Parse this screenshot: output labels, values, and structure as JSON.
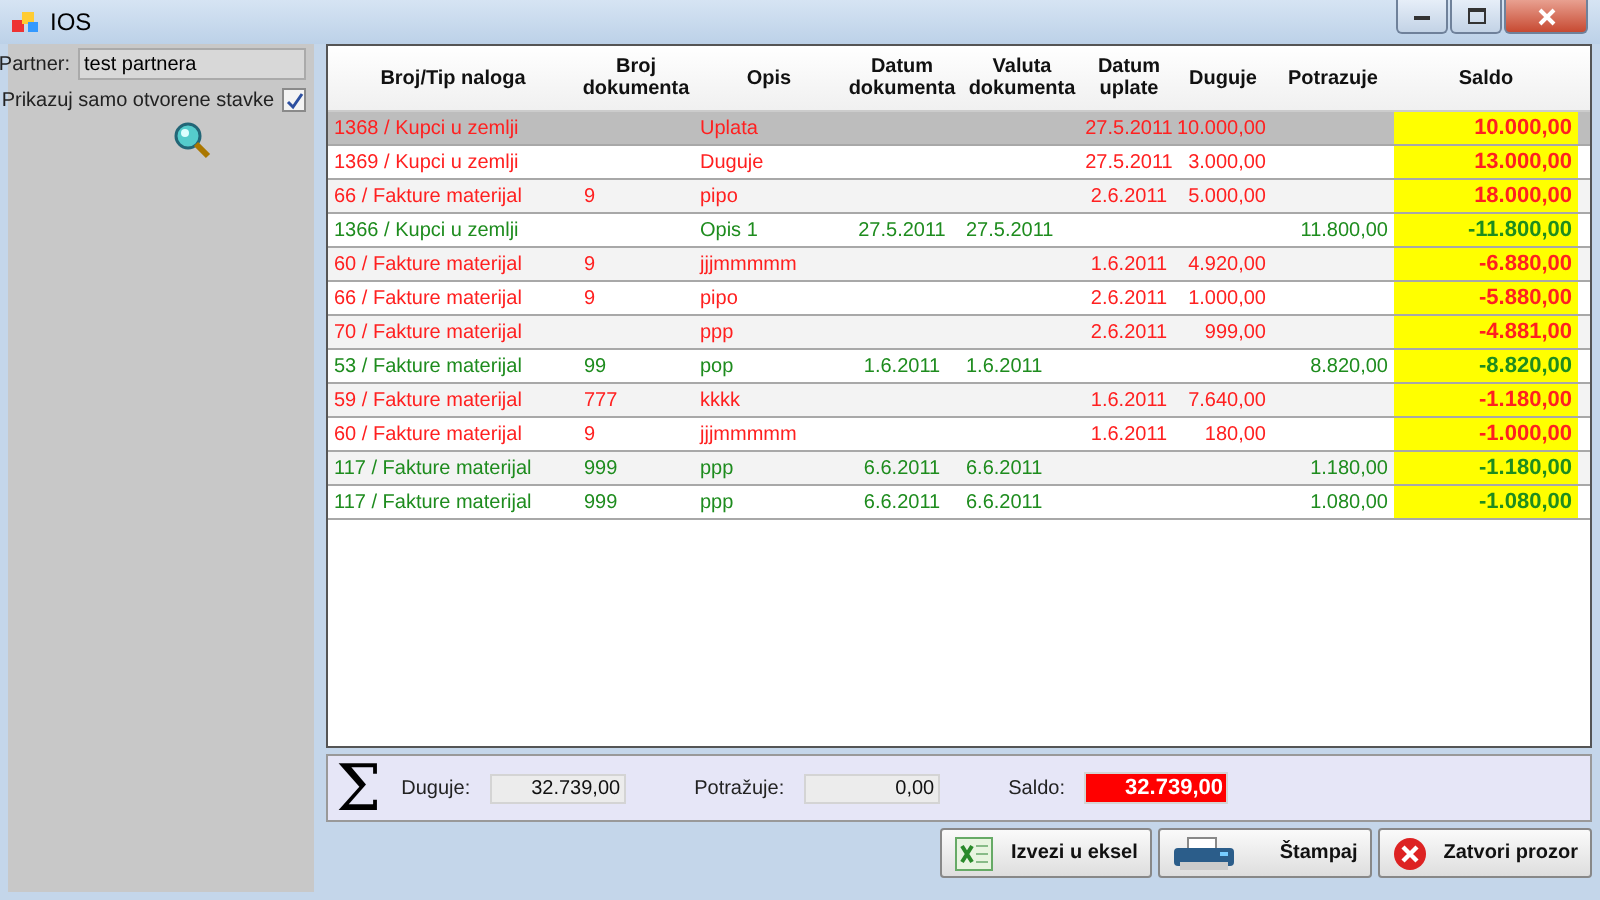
{
  "window": {
    "title": "IOS"
  },
  "filter": {
    "partner_label": "Partner:",
    "partner_value": "test partnera",
    "open_items_label": "Prikazuj samo otvorene stavke",
    "open_items_checked": true
  },
  "table": {
    "columns": [
      "Broj/Tip naloga",
      "Broj dokumenta",
      "Opis",
      "Datum dokumenta",
      "Valuta dokumenta",
      "Datum uplate",
      "Duguje",
      "Potrazuje",
      "Saldo"
    ],
    "rows": [
      {
        "selected": true,
        "color": "#ff2020",
        "cells": [
          "1368 / Kupci u zemlji",
          "",
          "Uplata",
          "",
          "",
          "27.5.2011",
          "10.000,00",
          "",
          "10.000,00"
        ]
      },
      {
        "selected": false,
        "color": "#ff2020",
        "cells": [
          "1369 / Kupci u zemlji",
          "",
          "Duguje",
          "",
          "",
          "27.5.2011",
          "3.000,00",
          "",
          "13.000,00"
        ]
      },
      {
        "selected": false,
        "color": "#ff2020",
        "cells": [
          "66 / Fakture materijal",
          "9",
          "pipo",
          "",
          "",
          "2.6.2011",
          "5.000,00",
          "",
          "18.000,00"
        ]
      },
      {
        "selected": false,
        "color": "#1e8c1e",
        "cells": [
          "1366 / Kupci u zemlji",
          "",
          "Opis 1",
          "27.5.2011",
          "27.5.2011",
          "",
          "",
          "11.800,00",
          "-11.800,00"
        ]
      },
      {
        "selected": false,
        "color": "#ff2020",
        "cells": [
          "60 / Fakture materijal",
          "9",
          "jjjmmmmm",
          "",
          "",
          "1.6.2011",
          "4.920,00",
          "",
          "-6.880,00"
        ]
      },
      {
        "selected": false,
        "color": "#ff2020",
        "cells": [
          "66 / Fakture materijal",
          "9",
          "pipo",
          "",
          "",
          "2.6.2011",
          "1.000,00",
          "",
          "-5.880,00"
        ]
      },
      {
        "selected": false,
        "color": "#ff2020",
        "cells": [
          "70 / Fakture materijal",
          "",
          "ppp",
          "",
          "",
          "2.6.2011",
          "999,00",
          "",
          "-4.881,00"
        ]
      },
      {
        "selected": false,
        "color": "#1e8c1e",
        "cells": [
          "53 / Fakture materijal",
          "99",
          "pop",
          "1.6.2011",
          "1.6.2011",
          "",
          "",
          "8.820,00",
          "-8.820,00"
        ]
      },
      {
        "selected": false,
        "color": "#ff2020",
        "cells": [
          "59 / Fakture materijal",
          "777",
          "kkkk",
          "",
          "",
          "1.6.2011",
          "7.640,00",
          "",
          "-1.180,00"
        ]
      },
      {
        "selected": false,
        "color": "#ff2020",
        "cells": [
          "60 / Fakture materijal",
          "9",
          "jjjmmmmm",
          "",
          "",
          "1.6.2011",
          "180,00",
          "",
          "-1.000,00"
        ]
      },
      {
        "selected": false,
        "color": "#1e8c1e",
        "cells": [
          "117 / Fakture materijal",
          "999",
          "ppp",
          "6.6.2011",
          "6.6.2011",
          "",
          "",
          "1.180,00",
          "-1.180,00"
        ]
      },
      {
        "selected": false,
        "color": "#1e8c1e",
        "cells": [
          "117 / Fakture materijal",
          "999",
          "ppp",
          "6.6.2011",
          "6.6.2011",
          "",
          "",
          "1.080,00",
          "-1.080,00"
        ]
      }
    ]
  },
  "totals": {
    "sigma": "Σ",
    "debit_label": "Duguje:",
    "debit_value": "32.739,00",
    "credit_label": "Potražuje:",
    "credit_value": "0,00",
    "saldo_label": "Saldo:",
    "saldo_value": "32.739,00"
  },
  "buttons": [
    {
      "kind": "excel",
      "label": "Izvezi u eksel"
    },
    {
      "kind": "print",
      "label": "Štampaj"
    },
    {
      "kind": "close",
      "label": "Zatvori prozor"
    }
  ]
}
